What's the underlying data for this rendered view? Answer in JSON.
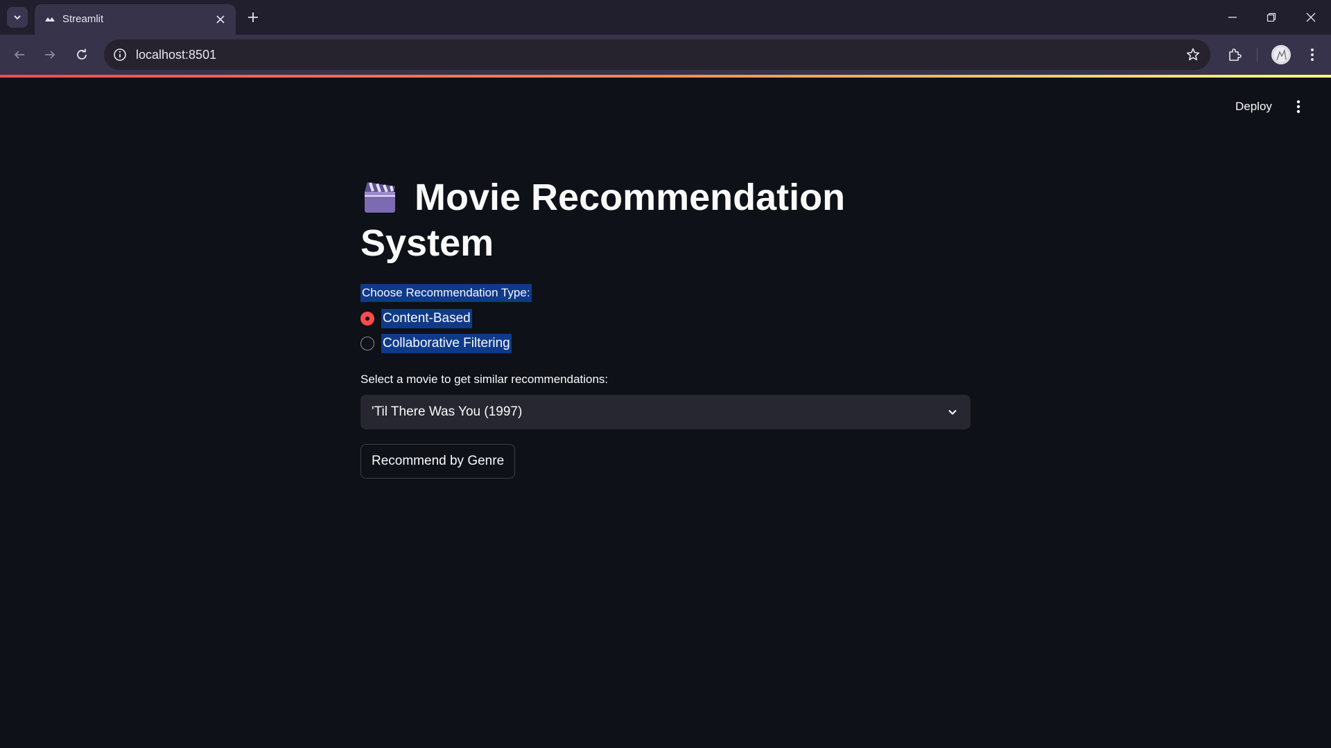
{
  "browser": {
    "tab_title": "Streamlit",
    "url": "localhost:8501"
  },
  "app": {
    "deploy_label": "Deploy",
    "title_line1": "Movie Recommendation",
    "title_line2": "System",
    "title_icon": "clapper-board-icon",
    "radio": {
      "label": "Choose Recommendation Type:",
      "options": [
        "Content-Based",
        "Collaborative Filtering"
      ],
      "selected": "Content-Based"
    },
    "movie_select": {
      "label": "Select a movie to get similar recommendations:",
      "value": "'Til There Was You (1997)"
    },
    "recommend_button": "Recommend by Genre"
  },
  "colors": {
    "background": "#0e1117",
    "primary": "#ff4b4b",
    "select_bg": "#262730",
    "highlight": "#0f3a8a"
  }
}
